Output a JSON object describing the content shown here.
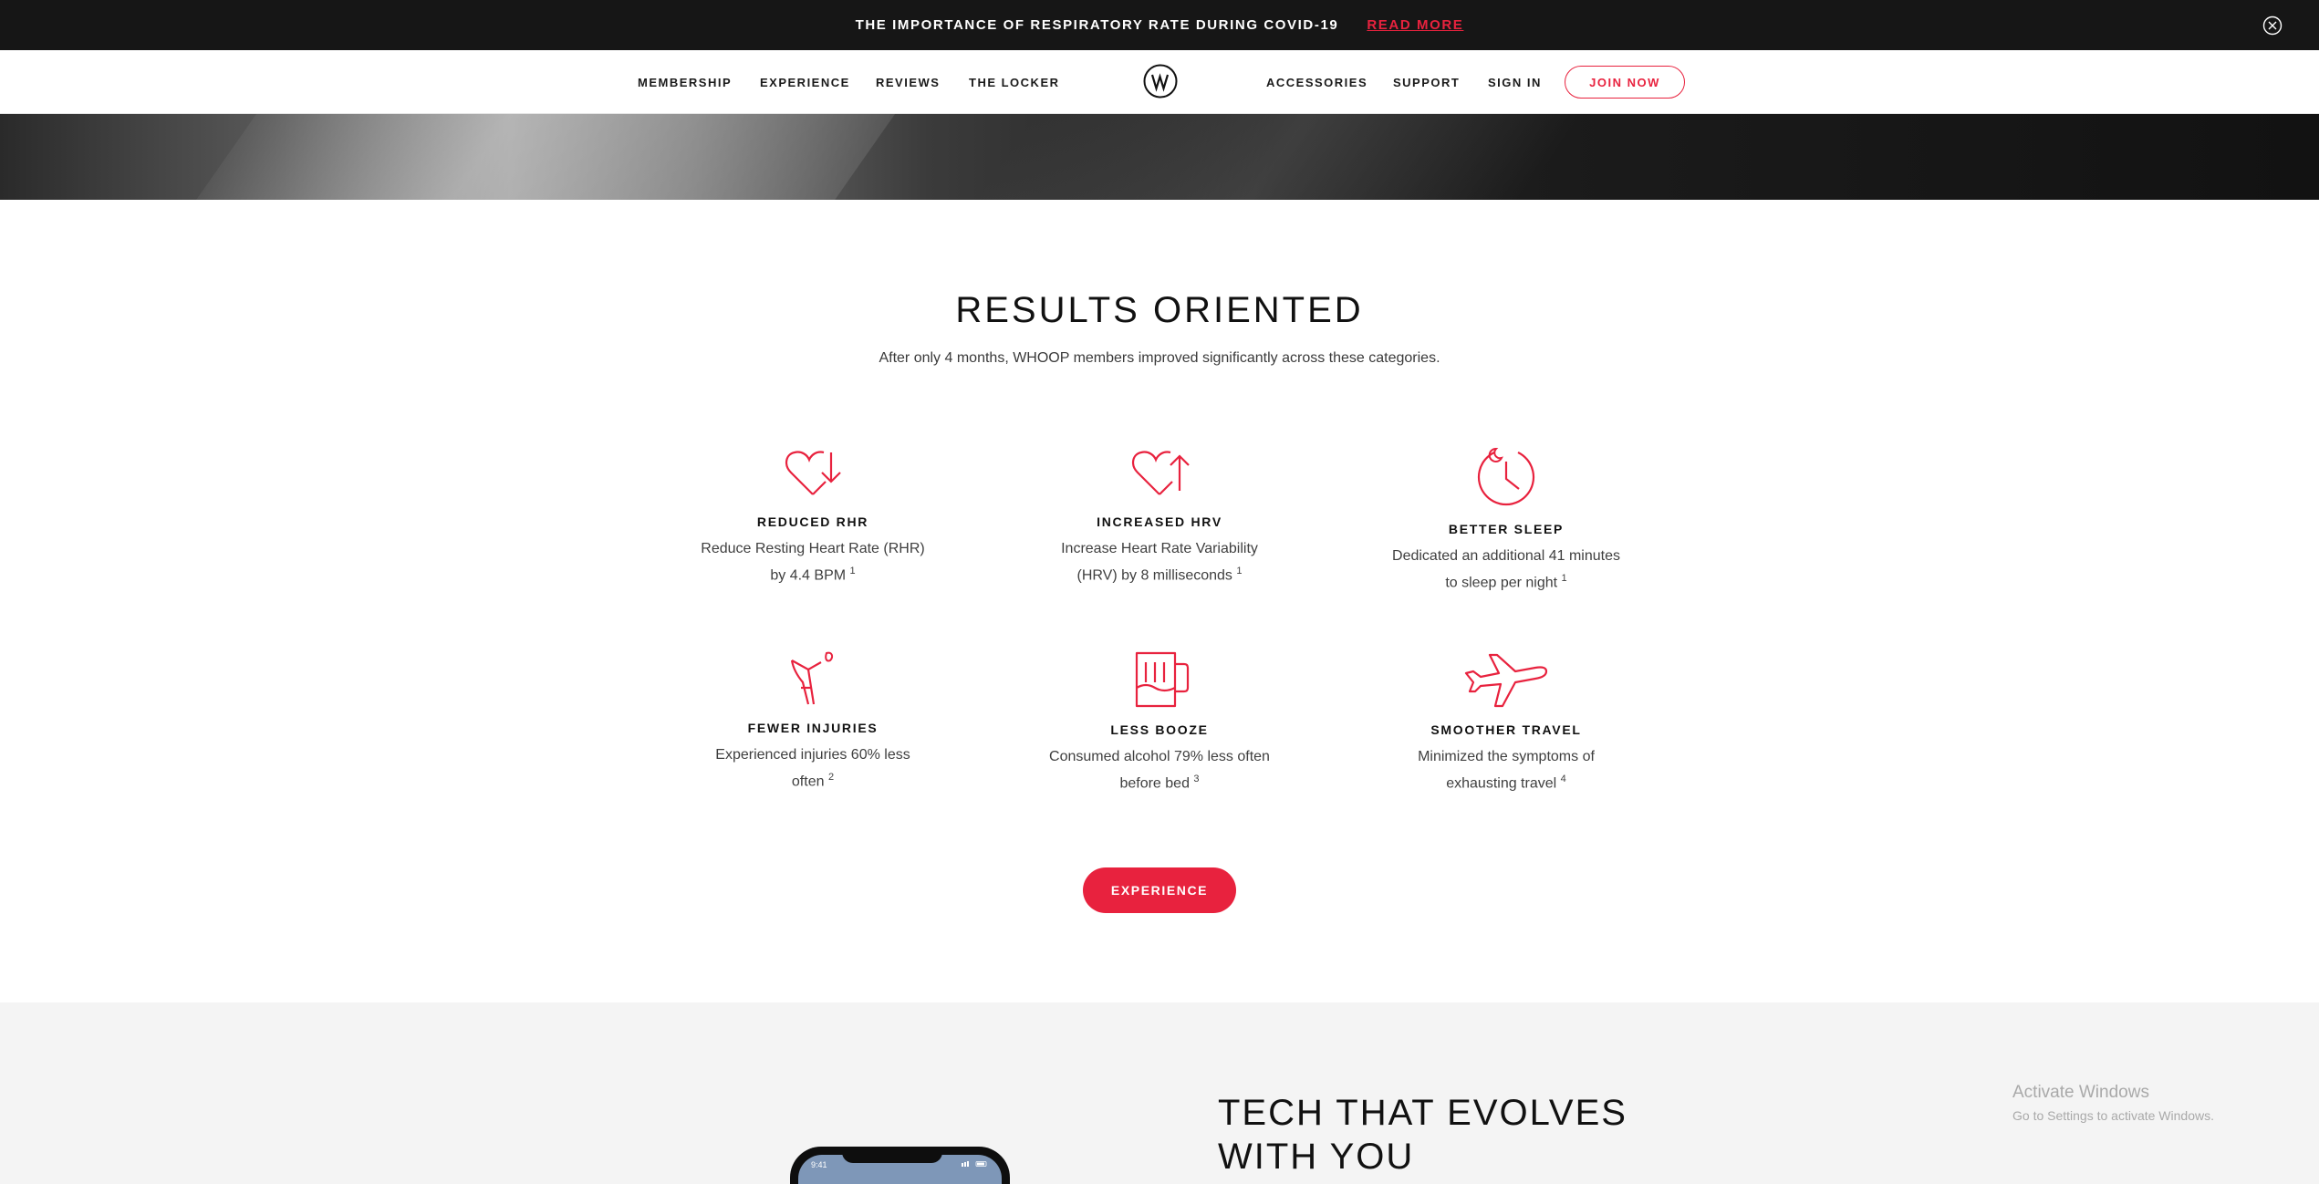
{
  "announcement": {
    "text": "THE IMPORTANCE OF RESPIRATORY RATE DURING COVID-19",
    "link": "READ MORE"
  },
  "nav": {
    "left": [
      "MEMBERSHIP",
      "EXPERIENCE",
      "REVIEWS",
      "THE LOCKER"
    ],
    "right": [
      "ACCESSORIES",
      "SUPPORT",
      "SIGN IN"
    ],
    "join": "JOIN NOW",
    "logo_icon": "whoop-logo-icon"
  },
  "results": {
    "title": "RESULTS ORIENTED",
    "subtitle": "After only 4 months, WHOOP members improved significantly across these categories.",
    "features": [
      {
        "icon": "heart-down-icon",
        "title": "REDUCED RHR",
        "line1": "Reduce Resting Heart Rate (RHR)",
        "line2": "by 4.4 BPM",
        "ref": "1"
      },
      {
        "icon": "heart-up-icon",
        "title": "INCREASED HRV",
        "line1": "Increase Heart Rate Variability",
        "line2": "(HRV) by 8 milliseconds",
        "ref": "1"
      },
      {
        "icon": "clock-moon-icon",
        "title": "BETTER SLEEP",
        "line1": "Dedicated an additional 41 minutes",
        "line2": "to sleep per night",
        "ref": "1"
      },
      {
        "icon": "crutch-icon",
        "title": "FEWER INJURIES",
        "line1": "Experienced injuries 60% less",
        "line2": "often",
        "ref": "2"
      },
      {
        "icon": "beer-mug-icon",
        "title": "LESS BOOZE",
        "line1": "Consumed alcohol 79% less often",
        "line2": "before bed",
        "ref": "3"
      },
      {
        "icon": "airplane-icon",
        "title": "SMOOTHER TRAVEL",
        "line1": "Minimized the symptoms of",
        "line2": "exhausting travel",
        "ref": "4"
      }
    ],
    "button": "EXPERIENCE"
  },
  "tech": {
    "title_line1": "TECH THAT EVOLVES",
    "title_line2": "WITH YOU",
    "phone_time": "9:41"
  },
  "watermark": {
    "title": "Activate Windows",
    "subtitle": "Go to Settings to activate Windows."
  },
  "colors": {
    "accent": "#e8223e",
    "dark_bar": "#161616",
    "tech_bg": "#f4f4f4"
  }
}
